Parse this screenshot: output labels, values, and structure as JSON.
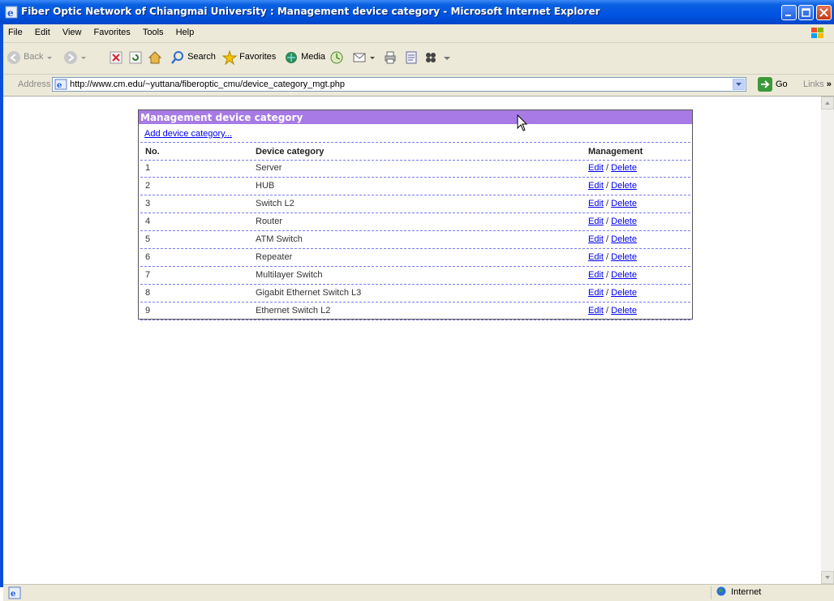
{
  "window": {
    "title": "Fiber Optic Network of Chiangmai University : Management device category - Microsoft Internet Explorer"
  },
  "menu": [
    "File",
    "Edit",
    "View",
    "Favorites",
    "Tools",
    "Help"
  ],
  "toolbar": {
    "back": "Back",
    "search": "Search",
    "favorites": "Favorites",
    "media": "Media"
  },
  "address": {
    "label": "Address",
    "url": "http://www.cm.edu/~yuttana/fiberoptic_cmu/device_category_mgt.php",
    "go": "Go",
    "links": "Links"
  },
  "panel": {
    "title": "Management device category",
    "add_link": "Add device category...",
    "columns": {
      "no": "No.",
      "category": "Device category",
      "management": "Management"
    },
    "edit_label": "Edit",
    "separator": "/",
    "delete_label": "Delete",
    "rows": [
      {
        "no": "1",
        "category": "Server"
      },
      {
        "no": "2",
        "category": "HUB"
      },
      {
        "no": "3",
        "category": "Switch L2"
      },
      {
        "no": "4",
        "category": "Router"
      },
      {
        "no": "5",
        "category": "ATM Switch"
      },
      {
        "no": "6",
        "category": "Repeater"
      },
      {
        "no": "7",
        "category": "Multilayer Switch"
      },
      {
        "no": "8",
        "category": "Gigabit Ethernet Switch L3"
      },
      {
        "no": "9",
        "category": "Ethernet Switch L2"
      }
    ]
  },
  "status": {
    "zone": "Internet"
  },
  "colors": {
    "title_bar": "#0054e3",
    "panel_header": "#a77ae6",
    "link": "#0000ee",
    "row_border": "#7a7af0"
  }
}
